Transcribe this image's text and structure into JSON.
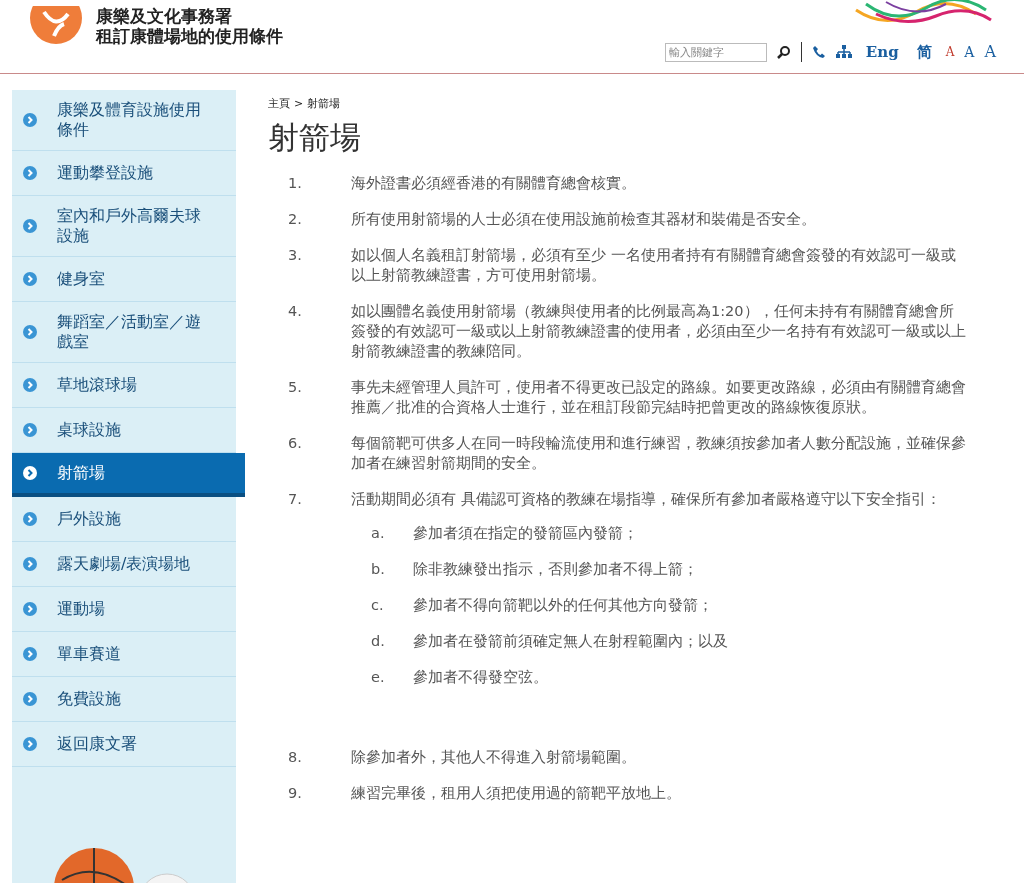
{
  "header": {
    "org_name": "康樂及文化事務署",
    "site_title": "租訂康體場地的使用條件",
    "search": {
      "placeholder": "輸入關鍵字"
    },
    "language_links": [
      "Eng",
      "简"
    ],
    "font_sizes": [
      "A",
      "A",
      "A"
    ]
  },
  "sidebar": {
    "items": [
      {
        "label": "康樂及體育設施使用條件",
        "selected": false
      },
      {
        "label": "運動攀登設施",
        "selected": false
      },
      {
        "label": "室內和戶外高爾夫球設施",
        "selected": false
      },
      {
        "label": "健身室",
        "selected": false
      },
      {
        "label": "舞蹈室／活動室／遊戲室",
        "selected": false
      },
      {
        "label": "草地滾球場",
        "selected": false
      },
      {
        "label": "桌球設施",
        "selected": false
      },
      {
        "label": "射箭場",
        "selected": true
      },
      {
        "label": "戶外設施",
        "selected": false
      },
      {
        "label": "露天劇場/表演場地",
        "selected": false
      },
      {
        "label": "運動場",
        "selected": false
      },
      {
        "label": "單車賽道",
        "selected": false
      },
      {
        "label": "免費設施",
        "selected": false
      },
      {
        "label": "返回康文署",
        "selected": false
      }
    ]
  },
  "breadcrumb": {
    "home": "主頁",
    "separator": ">",
    "current": "射箭場"
  },
  "page_title": "射箭場",
  "rules": [
    {
      "number": "1.",
      "text": "海外證書必須經香港的有關體育總會核實。"
    },
    {
      "number": "2.",
      "text": "所有使用射箭場的人士必須在使用設施前檢查其器材和裝備是否安全。"
    },
    {
      "number": "3.",
      "text": "如以個人名義租訂射箭場，必須有至少 一名使用者持有有關體育總會簽發的有效認可一級或以上射箭教練證書，方可使用射箭場。"
    },
    {
      "number": "4.",
      "text": "如以團體名義使用射箭場（教練與使用者的比例最高為1:20），任何未持有有關體育總會所簽發的有效認可一級或以上射箭教練證書的使用者，必須由至少一名持有有效認可一級或以上射箭教練證書的教練陪同。"
    },
    {
      "number": "5.",
      "text": "事先未經管理人員許可，使用者不得更改已設定的路線。如要更改路線，必須由有關體育總會推薦／批准的合資格人士進行，並在租訂段節完結時把曾更改的路線恢復原狀。"
    },
    {
      "number": "6.",
      "text": "每個箭靶可供多人在同一時段輪流使用和進行練習，教練須按參加者人數分配設施，並確保參加者在練習射箭期間的安全。"
    },
    {
      "number": "7.",
      "text": "活動期間必須有 具備認可資格的教練在場指導，確保所有參加者嚴格遵守以下安全指引：",
      "children": [
        {
          "number": "a.",
          "text": "參加者須在指定的發箭區內發箭；"
        },
        {
          "number": "b.",
          "text": "除非教練發出指示，否則參加者不得上箭；"
        },
        {
          "number": "c.",
          "text": "參加者不得向箭靶以外的任何其他方向發箭；"
        },
        {
          "number": "d.",
          "text": "參加者在發箭前須確定無人在射程範圍內；以及"
        },
        {
          "number": "e.",
          "text": "參加者不得發空弦。"
        }
      ]
    },
    {
      "number": "8.",
      "text": "除參加者外，其他人不得進入射箭場範圍。"
    },
    {
      "number": "9.",
      "text": "練習完畢後，租用人須把使用過的箭靶平放地上。"
    }
  ]
}
